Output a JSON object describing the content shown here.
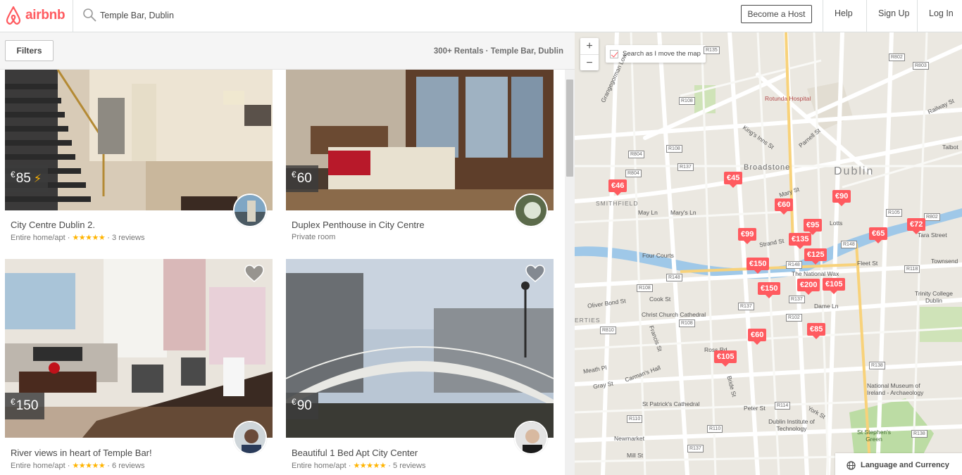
{
  "brand": {
    "name": "airbnb",
    "color": "#ff5a5f",
    "logo_icon": "airbnb-belo-icon"
  },
  "search": {
    "value": "Temple Bar, Dublin",
    "icon": "search-icon"
  },
  "nav": {
    "host": "Become a Host",
    "help": "Help",
    "signup": "Sign Up",
    "login": "Log In"
  },
  "filters": {
    "label": "Filters",
    "result_count": "300+ Rentals · Temple Bar, Dublin"
  },
  "listings": [
    {
      "price_currency": "€",
      "price_amount": "85",
      "instant_book": true,
      "title": "City Centre Dublin 2.",
      "room_type": "Entire home/apt",
      "rating_stars": "★★★★★",
      "reviews": "3 reviews"
    },
    {
      "price_currency": "€",
      "price_amount": "60",
      "instant_book": false,
      "title": "Duplex Penthouse in City Centre",
      "room_type": "Private room",
      "rating_stars": "",
      "reviews": ""
    },
    {
      "price_currency": "€",
      "price_amount": "150",
      "instant_book": false,
      "title": "River views in heart of Temple Bar!",
      "room_type": "Entire home/apt",
      "rating_stars": "★★★★★",
      "reviews": "6 reviews"
    },
    {
      "price_currency": "€",
      "price_amount": "90",
      "instant_book": false,
      "title": "Beautiful 1 Bed Apt City Center",
      "room_type": "Entire home/apt",
      "rating_stars": "★★★★★",
      "reviews": "5 reviews"
    }
  ],
  "separator": " · ",
  "map": {
    "zoom_in": "+",
    "zoom_out": "−",
    "search_as_move": "Search as I move the map",
    "language_currency": "Language and Currency",
    "markers": [
      "€46",
      "€45",
      "€90",
      "€60",
      "€99",
      "€95",
      "€135",
      "€65",
      "€72",
      "€125",
      "€150",
      "€150",
      "€200",
      "€105",
      "€60",
      "€85",
      "€105"
    ],
    "labels": {
      "rotunda": "Rotunda Hospital",
      "broadstone": "Broadstone",
      "dublin": "Dublin",
      "smithfield": "SMITHFIELD",
      "four_courts": "Four Courts",
      "national_wax": "The National Wax",
      "christ_church": "Christ Church Cathedral",
      "trinity": "Trinity College Dublin",
      "dame_ln": "Dame Ln",
      "st_patricks": "St Patrick's Cathedral",
      "dit": "Dublin Institute of Technology",
      "museum": "National Museum of Ireland - Archaeology",
      "stephens_green": "St Stephen's Green",
      "tara_street": "Tara Street",
      "townsend": "Townsend",
      "oliver_bond": "Oliver Bond St",
      "cook_st": "Cook St",
      "mary_st": "Mary St",
      "may_ln": "May Ln",
      "marys_ln": "Mary's Ln",
      "strand_st": "Strand St",
      "fleet_st": "Fleet St",
      "lotts": "Lotts",
      "parnell_st": "Parnell St",
      "kings_inns": "King's Inns St",
      "granby_ln": "Grangegorman Low",
      "railway_st": "Railway St",
      "talbot": "Talbot",
      "newmarket": "Newmarket",
      "mill_st": "Mill St",
      "peter_st": "Peter St",
      "york_st": "York St",
      "carmans_hall": "Carman's Hall",
      "meath_pl": "Meath Pl",
      "gray_st": "Gray St",
      "francis_st": "Francis St",
      "bride_st": "Bride St",
      "rose_pd": "Ross Rd",
      "erties": "ERTIES"
    },
    "shields": [
      "R135",
      "R802",
      "R803",
      "R108",
      "R108",
      "R804",
      "R804",
      "R105",
      "R802",
      "R148",
      "R148",
      "R118",
      "R108",
      "R148",
      "R137",
      "R137",
      "R108",
      "R810",
      "R138",
      "R114",
      "R110",
      "R110",
      "R137",
      "R138",
      "R137",
      "R102"
    ]
  }
}
